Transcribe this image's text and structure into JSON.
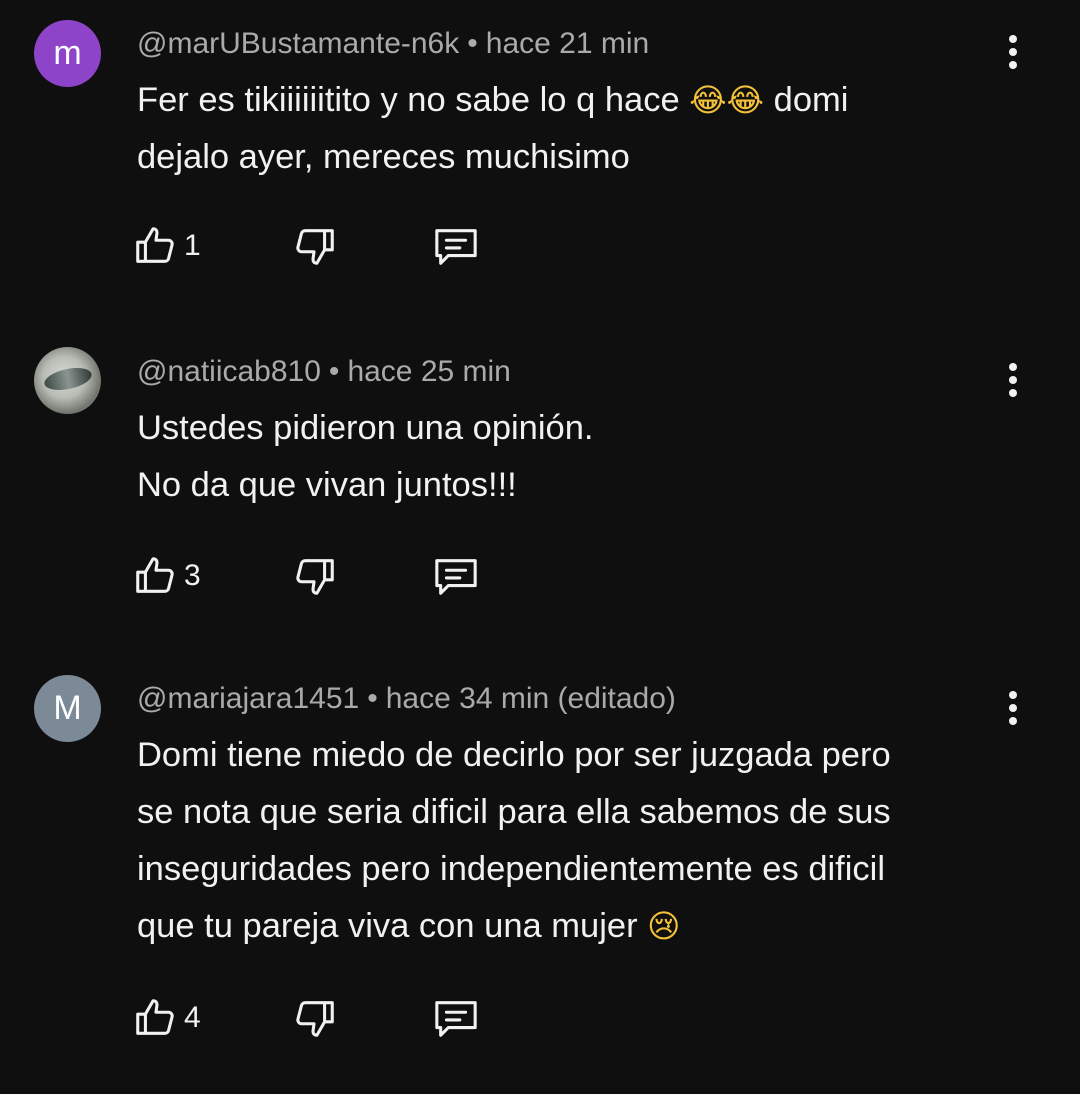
{
  "comments": [
    {
      "author": "@marUBustamante-n6k",
      "time": "hace 21 min",
      "avatar": {
        "type": "letter",
        "letter": "m",
        "color": "#8e44c9"
      },
      "lines": [
        "Fer es tikiiiiiitito y no sabe lo q hace",
        "dejalo ayer, mereces muchisimo"
      ],
      "line1_emoji": "😂😂",
      "line1_tail": "domi",
      "likes": "1"
    },
    {
      "author": "@natiicab810",
      "time": "hace 25 min",
      "avatar": {
        "type": "photo"
      },
      "lines": [
        "Ustedes pidieron una opinión.",
        "No da que vivan juntos!!!"
      ],
      "likes": "3"
    },
    {
      "author": "@mariajara1451",
      "time": "hace 34 min (editado)",
      "avatar": {
        "type": "letter",
        "letter": "M",
        "color": "#7b8a96"
      },
      "lines": [
        "Domi tiene miedo de decirlo por ser juzgada pero",
        "se nota que seria dificil para ella sabemos de sus",
        "inseguridades pero independientemente es dificil",
        "que tu pareja viva con una mujer"
      ],
      "last_emoji": "😢",
      "likes": "4"
    }
  ],
  "separator": "•",
  "icons": [
    "like-icon",
    "dislike-icon",
    "reply-icon",
    "more-vert-icon"
  ],
  "colors": {
    "background": "#0f0f0f",
    "text": "#f1f1f1",
    "meta": "#aaaaaa"
  }
}
